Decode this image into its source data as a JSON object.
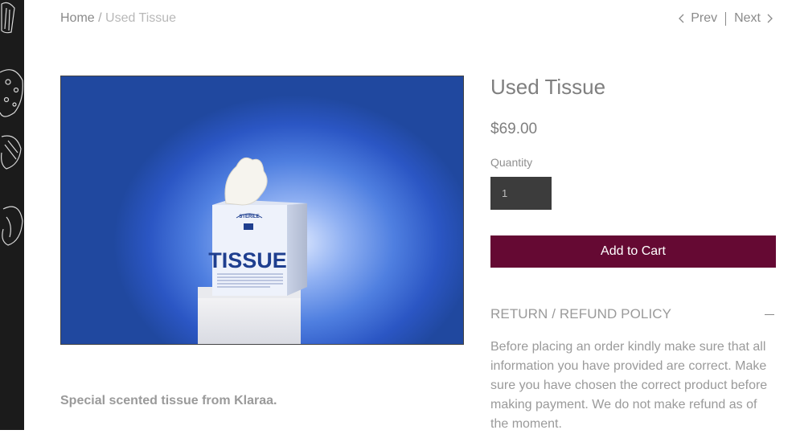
{
  "breadcrumb": {
    "home": "Home",
    "separator": " / ",
    "current": "Used Tissue"
  },
  "pager": {
    "prev": "Prev",
    "next": "Next"
  },
  "product": {
    "title": "Used Tissue",
    "price": "$69.00",
    "quantity_label": "Quantity",
    "quantity_value": "1",
    "add_to_cart": "Add to Cart",
    "description": "Special scented tissue from Klaraa.",
    "image": {
      "box_brand_top": "STERILE",
      "box_brand": "TISSUE"
    }
  },
  "policy": {
    "title": "RETURN / REFUND POLICY",
    "body": "Before placing an order kindly make sure that all information you have provided are correct. Make sure you have chosen the correct product before making payment. We do not make refund as of the moment."
  },
  "colors": {
    "accent": "#650933",
    "quantity_bg": "#3c3c3c",
    "side_strip": "#1b1b1b"
  },
  "icons": [
    "chevron-left-icon",
    "chevron-right-icon",
    "minus-icon"
  ]
}
